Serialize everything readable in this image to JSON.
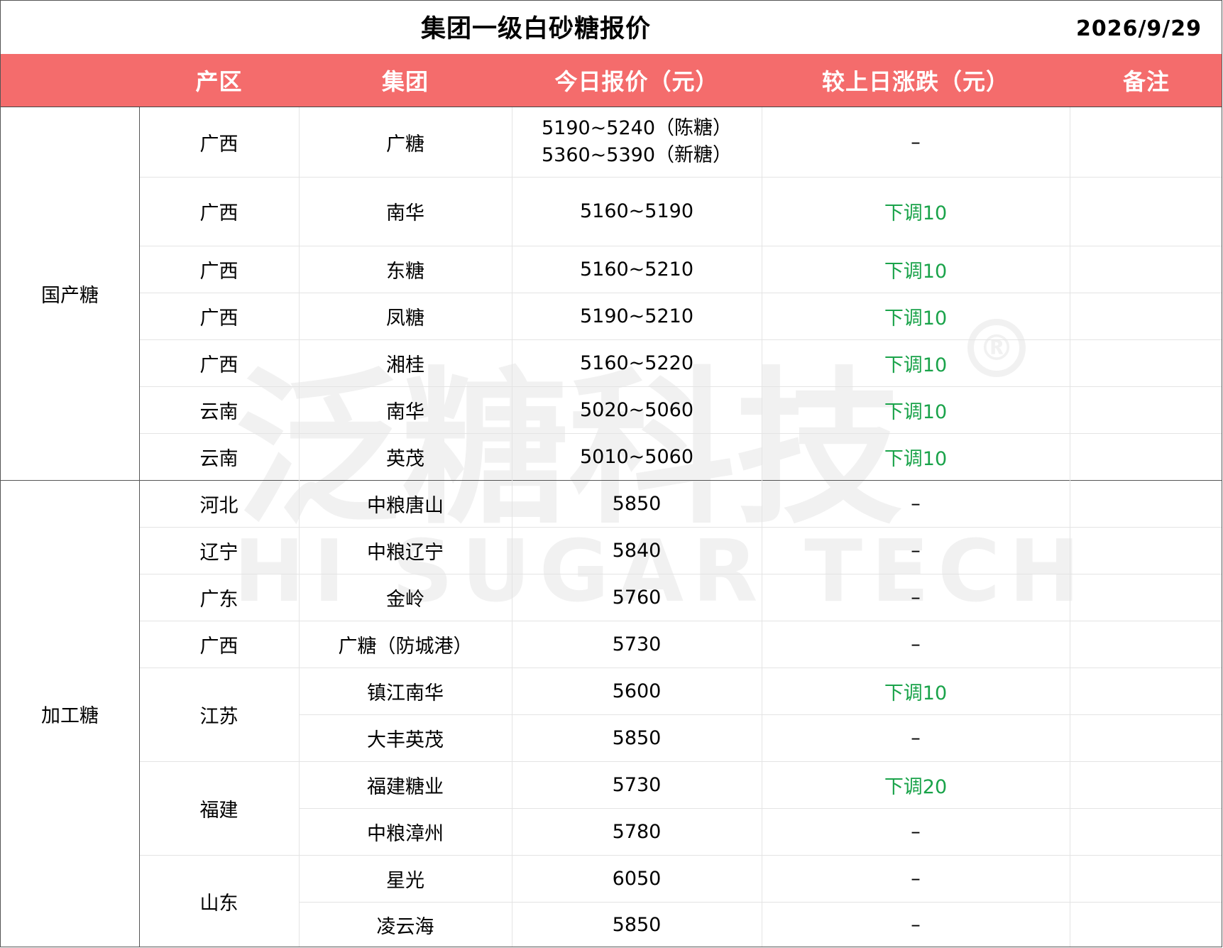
{
  "title": "集团一级白砂糖报价",
  "date": "2026/9/29",
  "columns": [
    "产区",
    "集团",
    "今日报价（元）",
    "较上日涨跌（元）",
    "备注"
  ],
  "groups": [
    {
      "label": "国产糖",
      "span": [
        0,
        7
      ]
    },
    {
      "label": "加工糖",
      "span": [
        7,
        17
      ]
    }
  ],
  "region_merges": [
    {
      "label": "江苏",
      "span": [
        11,
        13
      ]
    },
    {
      "label": "福建",
      "span": [
        13,
        15
      ]
    },
    {
      "label": "山东",
      "span": [
        15,
        17
      ]
    }
  ],
  "rows": [
    {
      "region": "广西",
      "company": "广糖",
      "price": [
        "5190~5240（陈糖）",
        "5360~5390（新糖）"
      ],
      "change": "–",
      "change_down": false,
      "remark": ""
    },
    {
      "region": "广西",
      "company": "南华",
      "price": [
        "5160~5190"
      ],
      "change": "下调10",
      "change_down": true,
      "remark": ""
    },
    {
      "region": "广西",
      "company": "东糖",
      "price": [
        "5160~5210"
      ],
      "change": "下调10",
      "change_down": true,
      "remark": ""
    },
    {
      "region": "广西",
      "company": "凤糖",
      "price": [
        "5190~5210"
      ],
      "change": "下调10",
      "change_down": true,
      "remark": ""
    },
    {
      "region": "广西",
      "company": "湘桂",
      "price": [
        "5160~5220"
      ],
      "change": "下调10",
      "change_down": true,
      "remark": ""
    },
    {
      "region": "云南",
      "company": "南华",
      "price": [
        "5020~5060"
      ],
      "change": "下调10",
      "change_down": true,
      "remark": ""
    },
    {
      "region": "云南",
      "company": "英茂",
      "price": [
        "5010~5060"
      ],
      "change": "下调10",
      "change_down": true,
      "remark": ""
    },
    {
      "region": "河北",
      "company": "中粮唐山",
      "price": [
        "5850"
      ],
      "change": "–",
      "change_down": false,
      "remark": ""
    },
    {
      "region": "辽宁",
      "company": "中粮辽宁",
      "price": [
        "5840"
      ],
      "change": "–",
      "change_down": false,
      "remark": ""
    },
    {
      "region": "广东",
      "company": "金岭",
      "price": [
        "5760"
      ],
      "change": "–",
      "change_down": false,
      "remark": ""
    },
    {
      "region": "广西",
      "company": "广糖（防城港）",
      "price": [
        "5730"
      ],
      "change": "–",
      "change_down": false,
      "remark": ""
    },
    {
      "region": "",
      "company": "镇江南华",
      "price": [
        "5600"
      ],
      "change": "下调10",
      "change_down": true,
      "remark": ""
    },
    {
      "region": "",
      "company": "大丰英茂",
      "price": [
        "5850"
      ],
      "change": "–",
      "change_down": false,
      "remark": ""
    },
    {
      "region": "",
      "company": "福建糖业",
      "price": [
        "5730"
      ],
      "change": "下调20",
      "change_down": true,
      "remark": ""
    },
    {
      "region": "",
      "company": "中粮漳州",
      "price": [
        "5780"
      ],
      "change": "–",
      "change_down": false,
      "remark": ""
    },
    {
      "region": "",
      "company": "星光",
      "price": [
        "6050"
      ],
      "change": "–",
      "change_down": false,
      "remark": ""
    },
    {
      "region": "",
      "company": "凌云海",
      "price": [
        "5850"
      ],
      "change": "–",
      "change_down": false,
      "remark": ""
    }
  ],
  "watermark": {
    "cn": "泛糖科技",
    "en": "HI SUGAR TECH",
    "mark": "®"
  },
  "colors": {
    "header_bg": "#f46c6c",
    "header_text": "#ffffff",
    "down_text": "#1aa34a"
  }
}
